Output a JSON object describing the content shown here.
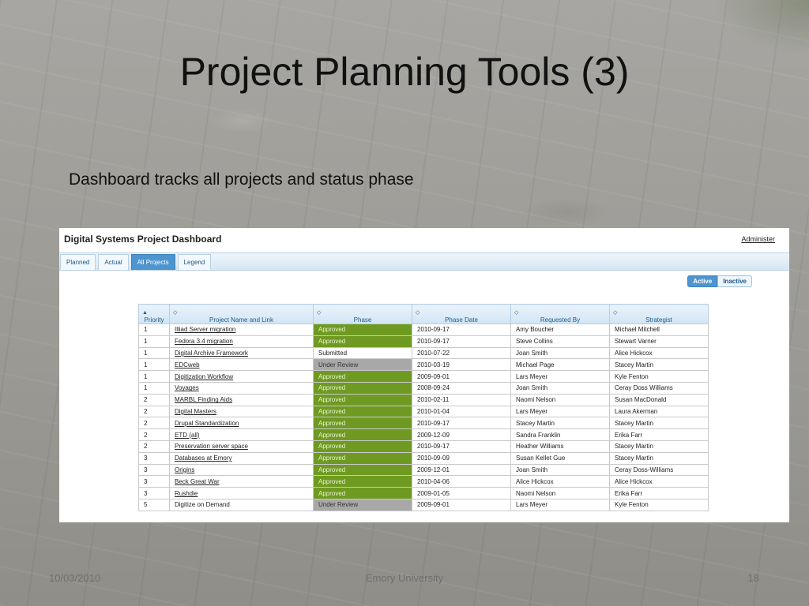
{
  "slide": {
    "title": "Project Planning Tools (3)",
    "subtitle": "Dashboard tracks all projects and status phase",
    "footer_left": "10/03/2010",
    "footer_center": "Emory University",
    "footer_right": "18"
  },
  "dashboard": {
    "title": "Digital Systems Project Dashboard",
    "admin_label": "Administer",
    "tabs": [
      {
        "label": "Planned",
        "active": false
      },
      {
        "label": "Actual",
        "active": false
      },
      {
        "label": "All Projects",
        "active": true
      },
      {
        "label": "Legend",
        "active": false
      }
    ],
    "toggle": {
      "active_label": "Active",
      "inactive_label": "Inactive",
      "selected": "Active"
    },
    "columns": [
      "Priority",
      "Project Name and Link",
      "Phase",
      "Phase Date",
      "Requested By",
      "Strategist"
    ],
    "sort_indicator_priority": "▲",
    "sort_indicator": "◇",
    "phase_colors": {
      "Approved": "#6f9a22",
      "Under Review": "#a8a8a8",
      "Submitted": "#ffffff"
    },
    "rows": [
      {
        "priority": "1",
        "name": "Illiad Server migration",
        "link": true,
        "phase": "Approved",
        "date": "2010-09-17",
        "requested_by": "Amy Boucher",
        "strategist": "Michael Mitchell"
      },
      {
        "priority": "1",
        "name": "Fedora 3.4 migration",
        "link": true,
        "phase": "Approved",
        "date": "2010-09-17",
        "requested_by": "Steve Collins",
        "strategist": "Stewart Varner"
      },
      {
        "priority": "1",
        "name": "Digital Archive Framework",
        "link": true,
        "phase": "Submitted",
        "date": "2010-07-22",
        "requested_by": "Joan Smith",
        "strategist": "Alice Hickcox"
      },
      {
        "priority": "1",
        "name": "EDCweb",
        "link": true,
        "phase": "Under Review",
        "date": "2010-03-19",
        "requested_by": "Michael Page",
        "strategist": "Stacey Martin"
      },
      {
        "priority": "1",
        "name": "Digitization Workflow",
        "link": true,
        "phase": "Approved",
        "date": "2009-09-01",
        "requested_by": "Lars Meyer",
        "strategist": "Kyle Fenton"
      },
      {
        "priority": "1",
        "name": "Voyages",
        "link": true,
        "phase": "Approved",
        "date": "2008-09-24",
        "requested_by": "Joan Smith",
        "strategist": "Ceray Doss Williams"
      },
      {
        "priority": "2",
        "name": "MARBL Finding Aids",
        "link": true,
        "phase": "Approved",
        "date": "2010-02-11",
        "requested_by": "Naomi Nelson",
        "strategist": "Susan MacDonald"
      },
      {
        "priority": "2",
        "name": "Digital Masters",
        "link": true,
        "phase": "Approved",
        "date": "2010-01-04",
        "requested_by": "Lars Meyer",
        "strategist": "Laura Akerman"
      },
      {
        "priority": "2",
        "name": "Drupal Standardization",
        "link": true,
        "phase": "Approved",
        "date": "2010-09-17",
        "requested_by": "Stacey Martin",
        "strategist": "Stacey Martin"
      },
      {
        "priority": "2",
        "name": "ETD (all)",
        "link": true,
        "phase": "Approved",
        "date": "2009-12-09",
        "requested_by": "Sandra Franklin",
        "strategist": "Erika Farr"
      },
      {
        "priority": "2",
        "name": "Preservation server space",
        "link": true,
        "phase": "Approved",
        "date": "2010-09-17",
        "requested_by": "Heather Williams",
        "strategist": "Stacey Martin"
      },
      {
        "priority": "3",
        "name": "Databases at Emory",
        "link": true,
        "phase": "Approved",
        "date": "2010-09-09",
        "requested_by": "Susan Kellet Gue",
        "strategist": "Stacey Martin"
      },
      {
        "priority": "3",
        "name": "Origins",
        "link": true,
        "phase": "Approved",
        "date": "2009-12-01",
        "requested_by": "Joan Smith",
        "strategist": "Ceray Doss-Williams"
      },
      {
        "priority": "3",
        "name": "Beck Great War",
        "link": true,
        "phase": "Approved",
        "date": "2010-04-06",
        "requested_by": "Alice Hickcox",
        "strategist": "Alice Hickcox"
      },
      {
        "priority": "3",
        "name": "Rushdie",
        "link": true,
        "phase": "Approved",
        "date": "2009-01-05",
        "requested_by": "Naomi Nelson",
        "strategist": "Erika Farr"
      },
      {
        "priority": "5",
        "name": "Digitize on Demand",
        "link": false,
        "phase": "Under Review",
        "date": "2009-09-01",
        "requested_by": "Lars Meyer",
        "strategist": "Kyle Fenton"
      }
    ]
  }
}
